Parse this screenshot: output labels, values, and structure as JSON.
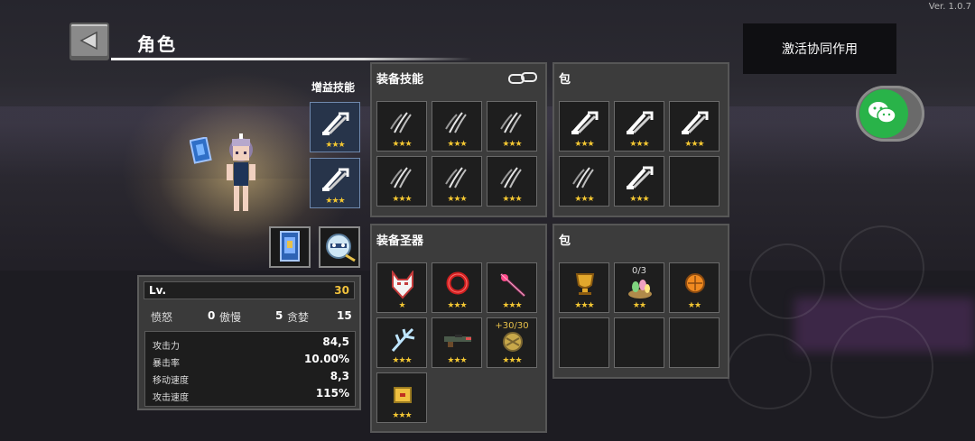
{
  "version": "Ver. 1.0.7",
  "header": {
    "title": "角色"
  },
  "synergy_button": {
    "label": "激活协同作用"
  },
  "chat_button": {
    "icon": "wechat-icon"
  },
  "buff_skills": {
    "label": "增益技能",
    "slots": [
      {
        "icon": "sword-slash-icon",
        "stars": "★★★"
      },
      {
        "icon": "sword-slash-icon",
        "stars": "★★★"
      }
    ]
  },
  "equipped_skills": {
    "title": "装备技能",
    "slots": [
      {
        "icon": "claw-slash-icon",
        "stars": "★★★"
      },
      {
        "icon": "claw-slash-icon",
        "stars": "★★★"
      },
      {
        "icon": "claw-slash-icon",
        "stars": "★★★"
      },
      {
        "icon": "claw-slash-icon",
        "stars": "★★★"
      },
      {
        "icon": "claw-slash-icon",
        "stars": "★★★"
      },
      {
        "icon": "claw-slash-icon",
        "stars": "★★★"
      }
    ]
  },
  "skill_bag": {
    "title": "包",
    "slots": [
      {
        "icon": "sword-slash-icon",
        "stars": "★★★"
      },
      {
        "icon": "sword-slash-icon",
        "stars": "★★★"
      },
      {
        "icon": "sword-slash-icon",
        "stars": "★★★"
      },
      {
        "icon": "claw-slash-icon",
        "stars": "★★★"
      },
      {
        "icon": "sword-slash-icon",
        "stars": "★★★"
      },
      {
        "icon": "",
        "stars": ""
      }
    ]
  },
  "equipped_relics": {
    "title": "装备圣器",
    "slots": [
      {
        "icon": "fox-mask-icon",
        "stars": "★",
        "top": ""
      },
      {
        "icon": "red-ring-icon",
        "stars": "★★★",
        "top": ""
      },
      {
        "icon": "crimson-staff-icon",
        "stars": "★★★",
        "top": ""
      },
      {
        "icon": "ice-antler-icon",
        "stars": "★★★",
        "top": ""
      },
      {
        "icon": "rifle-icon",
        "stars": "★★★",
        "top": ""
      },
      {
        "icon": "golden-orb-icon",
        "stars": "★★★",
        "top": "+30/30"
      },
      {
        "icon": "treasure-box-icon",
        "stars": "★★★",
        "top": ""
      }
    ]
  },
  "relic_bag": {
    "title": "包",
    "slots": [
      {
        "icon": "golden-trophy-icon",
        "stars": "★★★",
        "top": ""
      },
      {
        "icon": "gem-nest-icon",
        "stars": "★★",
        "top": "0/3"
      },
      {
        "icon": "orange-orb-icon",
        "stars": "★★",
        "top": ""
      },
      {
        "icon": "",
        "stars": "",
        "top": ""
      },
      {
        "icon": "",
        "stars": "",
        "top": ""
      },
      {
        "icon": "",
        "stars": "",
        "top": ""
      }
    ]
  },
  "character_slots": [
    {
      "icon": "blue-card-icon"
    },
    {
      "icon": "snowball-pet-icon"
    }
  ],
  "stats": {
    "level_label": "Lv.",
    "level_value": "30",
    "sins": [
      {
        "label": "愤怒",
        "value": "0"
      },
      {
        "label": "傲慢",
        "value": "5"
      },
      {
        "label": "贪婪",
        "value": "15"
      }
    ],
    "attributes": [
      {
        "label": "攻击力",
        "value": "84,5"
      },
      {
        "label": "暴击率",
        "value": "10.00%"
      },
      {
        "label": "移动速度",
        "value": "8,3"
      },
      {
        "label": "攻击速度",
        "value": "115%"
      }
    ]
  },
  "colors": {
    "star_gold": "#f2c632",
    "level_gold": "#f0c13c",
    "chat_green": "#29b349"
  }
}
